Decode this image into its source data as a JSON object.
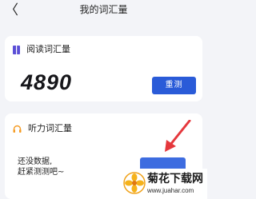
{
  "header": {
    "back_icon": "chevron-left-icon",
    "back_glyph": "〈",
    "title": "我的词汇量"
  },
  "reading": {
    "icon": "book-icon",
    "label": "阅读词汇量",
    "count": "4890",
    "retest_label": "重测"
  },
  "listening": {
    "icon": "headphones-icon",
    "label": "听力词汇量",
    "empty_line1": "还没数据,",
    "empty_line2": "赶紧测测吧~"
  },
  "watermark": {
    "title": "菊花下载网",
    "url": "www.juahar.com"
  },
  "colors": {
    "accent": "#2a5bd8",
    "icon_purple": "#5b4fd6",
    "icon_orange": "#f59b23",
    "arrow": "#e5373c",
    "background": "#f3f4f8"
  }
}
